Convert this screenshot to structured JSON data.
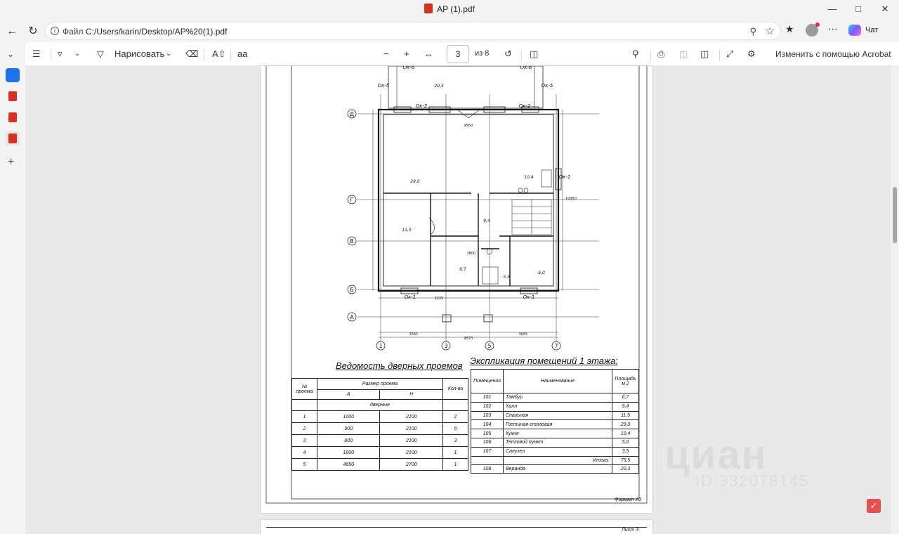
{
  "window": {
    "title": "AP (1).pdf"
  },
  "address": {
    "scheme": "Файл",
    "url": "C:/Users/karin/Desktop/AP%20(1).pdf"
  },
  "toolbar": {
    "draw_label": "Нарисовать",
    "page_current": "3",
    "page_total": "из 8",
    "acrobat_label": "Изменить с помощью Acrobat"
  },
  "chat_label": "Чат",
  "drawing": {
    "grid_rows": [
      "Д",
      "Г",
      "В",
      "Б",
      "А"
    ],
    "grid_cols": [
      "1",
      "3",
      "5",
      "7"
    ],
    "window_marks": [
      "Ок-2",
      "Ок-2",
      "Ок-1",
      "Ок-1",
      "Ок-5",
      "Ок-5",
      "Ок-6",
      "Ок-6",
      "Ок-1"
    ],
    "dims": [
      "3565",
      "3665",
      "9570",
      "9950",
      "10950",
      "1800",
      "2225"
    ],
    "room_areas": [
      "29,0",
      "10,4",
      "11,5",
      "9,4",
      "6,7",
      "5,0",
      "3,5",
      "20,3"
    ]
  },
  "doors": {
    "title": "Ведомость дверных проемов",
    "head_num": "№ проема",
    "head_size": "Размер проема",
    "head_a": "А",
    "head_h": "Н",
    "head_qty": "Кол-во",
    "group": "дверные",
    "rows": [
      {
        "n": "1",
        "a": "1000",
        "h": "2100",
        "q": "2"
      },
      {
        "n": "2",
        "a": "900",
        "h": "2100",
        "q": "6"
      },
      {
        "n": "3",
        "a": "800",
        "h": "2100",
        "q": "3"
      },
      {
        "n": "4",
        "a": "1800",
        "h": "2100",
        "q": "1"
      },
      {
        "n": "5",
        "a": "4650",
        "h": "2700",
        "q": "1"
      }
    ]
  },
  "rooms": {
    "title": "Экспликация помещений 1 этажа:",
    "head_room": "Помещения",
    "head_name": "Наименование",
    "head_area": "Площадь м 2",
    "rows": [
      {
        "n": "101",
        "name": "Тамбур",
        "area": "6,7"
      },
      {
        "n": "102",
        "name": "Холл",
        "area": "9,4"
      },
      {
        "n": "103",
        "name": "Спальная",
        "area": "11,5"
      },
      {
        "n": "104",
        "name": "Гостиная-столовая",
        "area": "29,0"
      },
      {
        "n": "105",
        "name": "Кухня",
        "area": "10,4"
      },
      {
        "n": "106",
        "name": "Тепловой пункт",
        "area": "5,0"
      },
      {
        "n": "107",
        "name": "Санузел",
        "area": "3,5"
      }
    ],
    "total_label": "Итого:",
    "total": "75,5",
    "extra": {
      "n": "108",
      "name": "Веранда",
      "area": "20,3"
    }
  },
  "stamp": "Формат А3",
  "next_page_stamp": "Лист 3",
  "watermark": {
    "brand": "циан",
    "id": "ID 332078145"
  }
}
